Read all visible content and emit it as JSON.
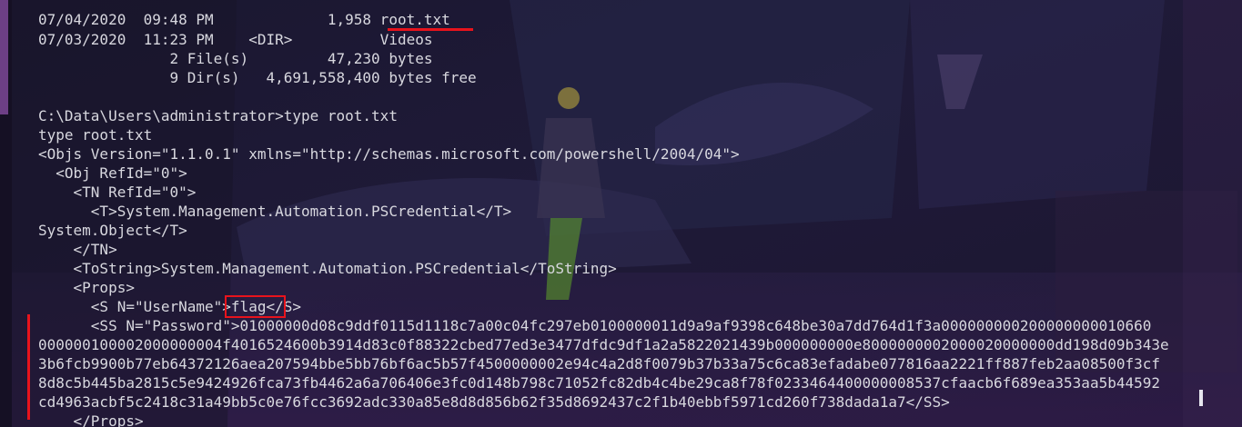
{
  "terminal": {
    "lines": [
      "07/04/2020  09:48 PM             1,958 root.txt",
      "07/03/2020  11:23 PM    <DIR>          Videos",
      "               2 File(s)         47,230 bytes",
      "               9 Dir(s)   4,691,558,400 bytes free",
      "",
      "C:\\Data\\Users\\administrator>type root.txt",
      "type root.txt",
      "<Objs Version=\"1.1.0.1\" xmlns=\"http://schemas.microsoft.com/powershell/2004/04\">",
      "  <Obj RefId=\"0\">",
      "    <TN RefId=\"0\">",
      "      <T>System.Management.Automation.PSCredential</T>",
      "System.Object</T>",
      "    </TN>",
      "    <ToString>System.Management.Automation.PSCredential</ToString>",
      "    <Props>",
      "      <S N=\"UserName\">flag</S>",
      "      <SS N=\"Password\">01000000d08c9ddf0115d1118c7a00c04fc297eb0100000011d9a9af9398c648be30a7dd764d1f3a000000000200000000010660",
      "000000100002000000004f4016524600b3914d83c0f88322cbed77ed3e3477dfdc9df1a2a5822021439b000000000e8000000002000020000000dd198d09b343e",
      "3b6fcb9900b77eb64372126aea207594bbe5bb76bf6ac5b57f4500000002e94c4a2d8f0079b37b33a75c6ca83efadabe077816aa2221ff887feb2aa08500f3cf",
      "8d8c5b445ba2815c5e9424926fca73fb4462a6a706406e3fc0d148b798c71052fc82db4c4be29ca8f78f0233464400000008537cfaacb6f689ea353aa5b44592",
      "cd4963acbf5c2418c31a49bb5c0e76fcc3692adc330a85e8d8d856b62f35d8692437c2f1b40ebbf5971cd260f738dada1a7</SS>",
      "    </Props>"
    ]
  },
  "colors": {
    "text": "#d8d8df",
    "annotation_red": "#e8131c",
    "background": "#1c1830"
  }
}
